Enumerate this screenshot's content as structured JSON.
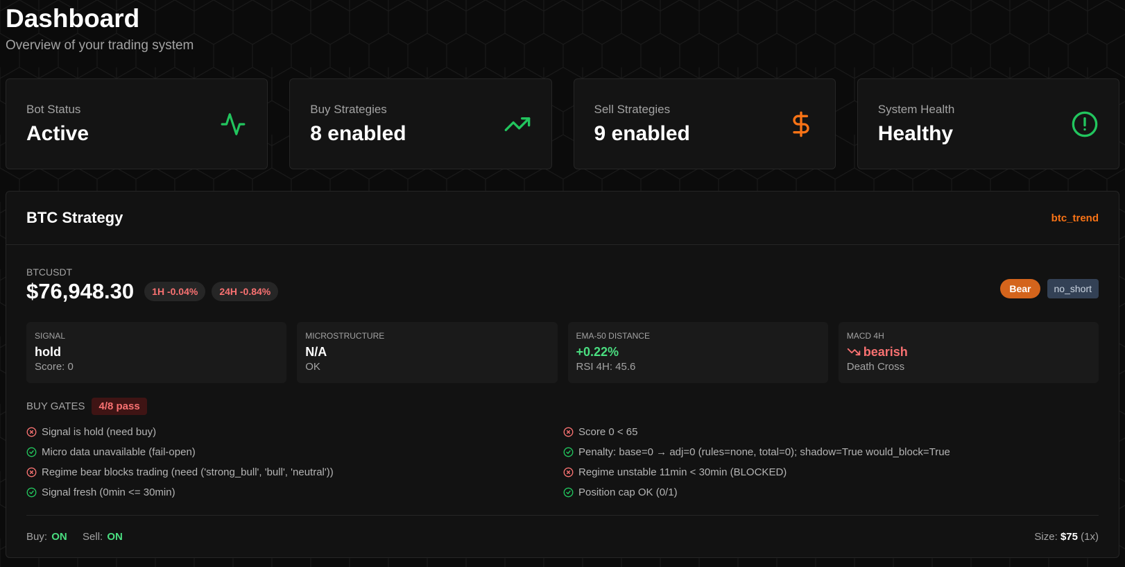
{
  "header": {
    "title": "Dashboard",
    "subtitle": "Overview of your trading system"
  },
  "stats": [
    {
      "label": "Bot Status",
      "value": "Active",
      "icon": "activity-icon",
      "color": "#22c55e"
    },
    {
      "label": "Buy Strategies",
      "value": "8 enabled",
      "icon": "trending-up-icon",
      "color": "#22c55e"
    },
    {
      "label": "Sell Strategies",
      "value": "9 enabled",
      "icon": "dollar-icon",
      "color": "#f97316"
    },
    {
      "label": "System Health",
      "value": "Healthy",
      "icon": "alert-circle-icon",
      "color": "#22c55e"
    }
  ],
  "strategy": {
    "title": "BTC Strategy",
    "tag": "btc_trend",
    "symbol": "BTCUSDT",
    "price": "$76,948.30",
    "change_1h": "1H -0.04%",
    "change_24h": "24H -0.84%",
    "regime_badge": "Bear",
    "mode_badge": "no_short",
    "metrics": [
      {
        "label": "Signal",
        "value": "hold",
        "sub": "Score: 0"
      },
      {
        "label": "Microstructure",
        "value": "N/A",
        "sub": "OK"
      },
      {
        "label": "EMA-50 Distance",
        "value": "+0.22%",
        "sub": "RSI 4H: 45.6"
      },
      {
        "label": "MACD 4H",
        "value": "bearish",
        "sub": "Death Cross",
        "icon": "trending-down-icon"
      }
    ],
    "gates_label": "BUY GATES",
    "gates_pass": "4/8 pass",
    "gates_left": [
      {
        "text": "Signal is hold (need buy)",
        "status": "fail"
      },
      {
        "text": "Micro data unavailable (fail-open)",
        "status": "pass"
      },
      {
        "text": "Regime bear blocks trading (need ('strong_bull', 'bull', 'neutral'))",
        "status": "fail"
      },
      {
        "text": "Signal fresh (0min <= 30min)",
        "status": "pass"
      }
    ],
    "gates_right": [
      {
        "text": "Score 0 < 65",
        "status": "fail"
      },
      {
        "text": "Penalty: base=0 → adj=0 (rules=none, total=0); shadow=True would_block=True",
        "status": "pass"
      },
      {
        "text": "Regime unstable 11min < 30min (BLOCKED)",
        "status": "fail"
      },
      {
        "text": "Position cap OK (0/1)",
        "status": "pass"
      }
    ],
    "footer": {
      "buy_label": "Buy:",
      "buy_value": "ON",
      "sell_label": "Sell:",
      "sell_value": "ON",
      "size_label": "Size:",
      "size_value": "$75",
      "size_mult": "(1x)"
    }
  },
  "colors": {
    "accent": "#f97316",
    "positive": "#4ade80",
    "negative": "#f87171",
    "background": "#0b0b0b"
  }
}
